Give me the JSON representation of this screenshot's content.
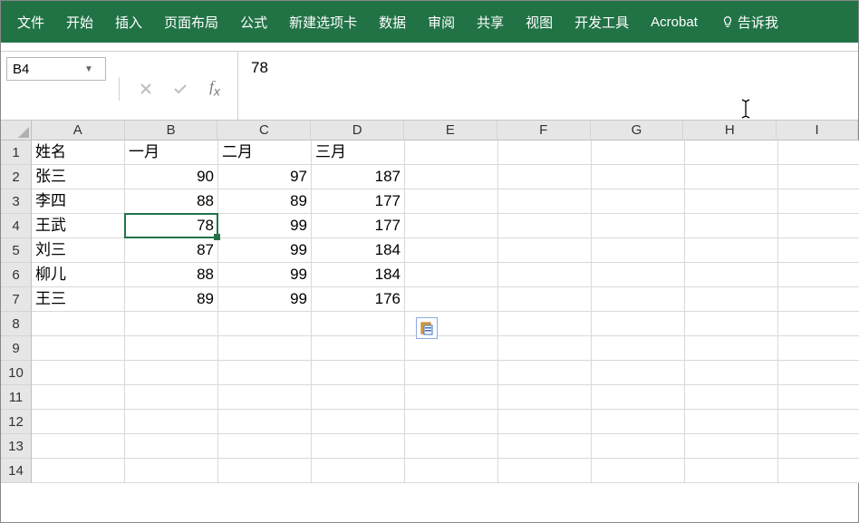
{
  "ribbon": {
    "tabs": [
      "文件",
      "开始",
      "插入",
      "页面布局",
      "公式",
      "新建选项卡",
      "数据",
      "审阅",
      "共享",
      "视图",
      "开发工具",
      "Acrobat"
    ],
    "tell_me": "告诉我"
  },
  "name_box": {
    "value": "B4"
  },
  "formula_bar": {
    "value": "78"
  },
  "columns": [
    "A",
    "B",
    "C",
    "D",
    "E",
    "F",
    "G",
    "H",
    "I"
  ],
  "row_numbers": [
    "1",
    "2",
    "3",
    "4",
    "5",
    "6",
    "7",
    "8",
    "9",
    "10",
    "11",
    "12",
    "13",
    "14"
  ],
  "active_cell": {
    "row": 4,
    "col": 2
  },
  "chart_data": {
    "type": "table",
    "columns": [
      "姓名",
      "一月",
      "二月",
      "三月"
    ],
    "rows": [
      {
        "姓名": "张三",
        "一月": 90,
        "二月": 97,
        "三月": 187
      },
      {
        "姓名": "李四",
        "一月": 88,
        "二月": 89,
        "三月": 177
      },
      {
        "姓名": "王武",
        "一月": 78,
        "二月": 99,
        "三月": 177
      },
      {
        "姓名": "刘三",
        "一月": 87,
        "二月": 99,
        "三月": 184
      },
      {
        "姓名": "柳儿",
        "一月": 88,
        "二月": 99,
        "三月": 184
      },
      {
        "姓名": "王三",
        "一月": 89,
        "二月": 99,
        "三月": 176
      }
    ]
  },
  "sheet": {
    "header": {
      "A": "姓名",
      "B": "一月",
      "C": "二月",
      "D": "三月"
    },
    "rows": [
      {
        "A": "张三",
        "B": "90",
        "C": "97",
        "D": "187"
      },
      {
        "A": "李四",
        "B": "88",
        "C": "89",
        "D": "177"
      },
      {
        "A": "王武",
        "B": "78",
        "C": "99",
        "D": "177"
      },
      {
        "A": "刘三",
        "B": "87",
        "C": "99",
        "D": "184"
      },
      {
        "A": "柳儿",
        "B": "88",
        "C": "99",
        "D": "184"
      },
      {
        "A": "王三",
        "B": "89",
        "C": "99",
        "D": "176"
      }
    ]
  }
}
